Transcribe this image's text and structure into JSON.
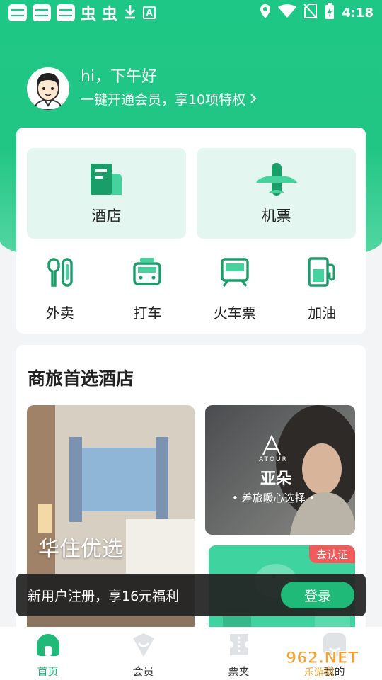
{
  "colors": {
    "brand": "#1fc585",
    "brand_dark": "#1a9e68",
    "tile_bg": "#e3f6ef",
    "badge_red": "#f15b5b"
  },
  "status_bar": {
    "time": "4:18",
    "notification_icons": [
      "app-icon",
      "app-icon",
      "app-icon",
      "bug-icon",
      "bug-icon",
      "download-icon",
      "a-icon"
    ],
    "glyph": "虫",
    "a_label": "A",
    "right_icons": [
      "location-icon",
      "wifi-icon",
      "no-sim-icon",
      "battery-icon"
    ]
  },
  "greeting": {
    "hello": "hi，下午好",
    "member_promo": "一键开通会员，享10项特权"
  },
  "services": {
    "big": [
      {
        "id": "hotel",
        "label": "酒店",
        "icon": "hotel-icon"
      },
      {
        "id": "flight",
        "label": "机票",
        "icon": "plane-icon"
      }
    ],
    "small": [
      {
        "id": "takeout",
        "label": "外卖",
        "icon": "takeout-icon"
      },
      {
        "id": "taxi",
        "label": "打车",
        "icon": "car-icon"
      },
      {
        "id": "train",
        "label": "火车票",
        "icon": "train-icon"
      },
      {
        "id": "fuel",
        "label": "加油",
        "icon": "fuel-icon"
      }
    ]
  },
  "hotels": {
    "title": "商旅首选酒店",
    "huazhu": {
      "name": "华住优选"
    },
    "atour": {
      "logo_text": "ATOUR",
      "name": "亚朵",
      "tagline": "• 差旅暖心选择 •"
    },
    "verify": {
      "badge": "去认证"
    }
  },
  "login_banner": {
    "text": "新用户注册，享16元福利",
    "button": "登录"
  },
  "bottom_nav": [
    {
      "label": "首页",
      "icon": "home-icon",
      "active": true
    },
    {
      "label": "会员",
      "icon": "member-icon",
      "active": false
    },
    {
      "label": "票夹",
      "icon": "ticket-icon",
      "active": false
    },
    {
      "label": "我的",
      "icon": "profile-icon",
      "active": false
    }
  ],
  "watermark": {
    "text": "962.NET",
    "subtext": "乐游网"
  }
}
